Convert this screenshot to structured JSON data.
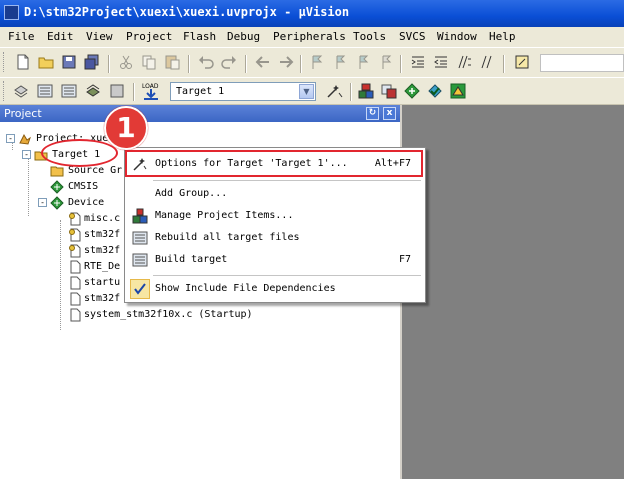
{
  "window": {
    "title": "D:\\stm32Project\\xuexi\\xuexi.uvprojx - µVision"
  },
  "menu": [
    "File",
    "Edit",
    "View",
    "Project",
    "Flash",
    "Debug",
    "Peripherals",
    "Tools",
    "SVCS",
    "Window",
    "Help"
  ],
  "toolbar": {
    "target_select": "Target 1",
    "load_label": "LOAD"
  },
  "panel": {
    "title": "Project",
    "close": "x"
  },
  "tree": {
    "project": "Project: xue",
    "target": "Target 1",
    "source_group": "Source Gr",
    "cmsis": "CMSIS",
    "device": "Device",
    "files": [
      "misc.c",
      "stm32f",
      "stm32f",
      "RTE_De",
      "startu",
      "stm32f",
      "system_stm32f10x.c (Startup)"
    ]
  },
  "context_menu": {
    "items": [
      {
        "label": "Options for Target 'Target 1'...",
        "shortcut": "Alt+F7"
      },
      {
        "label": "Add Group...",
        "shortcut": ""
      },
      {
        "label": "Manage Project Items...",
        "shortcut": ""
      },
      {
        "label": "Rebuild all target files",
        "shortcut": ""
      },
      {
        "label": "Build target",
        "shortcut": "F7"
      },
      {
        "label": "Show Include File Dependencies",
        "shortcut": ""
      }
    ]
  },
  "annotation": {
    "step": "1",
    "color": "#e2262f"
  },
  "colors": {
    "titlebar": "#0a4fd6",
    "chrome": "#ece9d8",
    "workspace": "#808080",
    "panel_header": "#3c66c4"
  }
}
